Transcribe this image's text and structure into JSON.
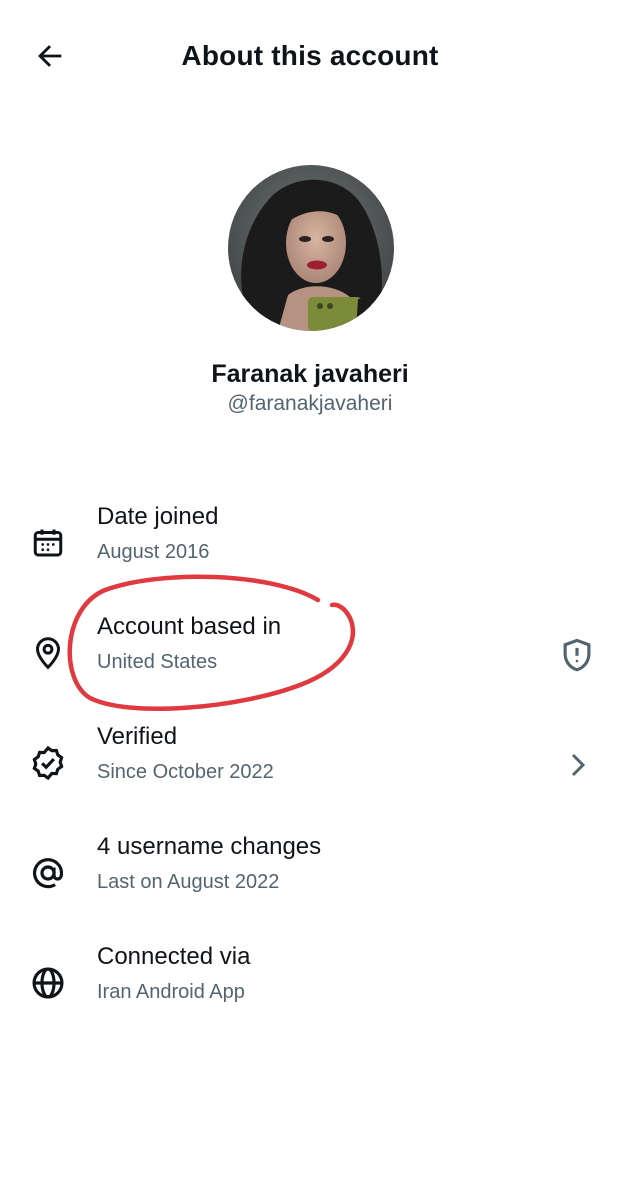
{
  "header": {
    "title": "About this account",
    "back_icon": "arrow-left-icon"
  },
  "profile": {
    "display_name": "Faranak javaheri",
    "handle": "@faranakjavaheri"
  },
  "rows": [
    {
      "icon": "calendar-icon",
      "title": "Date joined",
      "subtitle": "August 2016"
    },
    {
      "icon": "location-pin-icon",
      "title": "Account based in",
      "subtitle": "United States",
      "trailing_icon": "shield-alert-icon"
    },
    {
      "icon": "verified-badge-icon",
      "title": "Verified",
      "subtitle": "Since October 2022",
      "trailing_icon": "chevron-right-icon"
    },
    {
      "icon": "at-sign-icon",
      "title": "4 username changes",
      "subtitle": "Last on August 2022"
    },
    {
      "icon": "globe-icon",
      "title": "Connected via",
      "subtitle": "Iran Android App"
    }
  ],
  "colors": {
    "text_primary": "#0f1419",
    "text_secondary": "#536471",
    "annotation_red": "#e0393f"
  }
}
